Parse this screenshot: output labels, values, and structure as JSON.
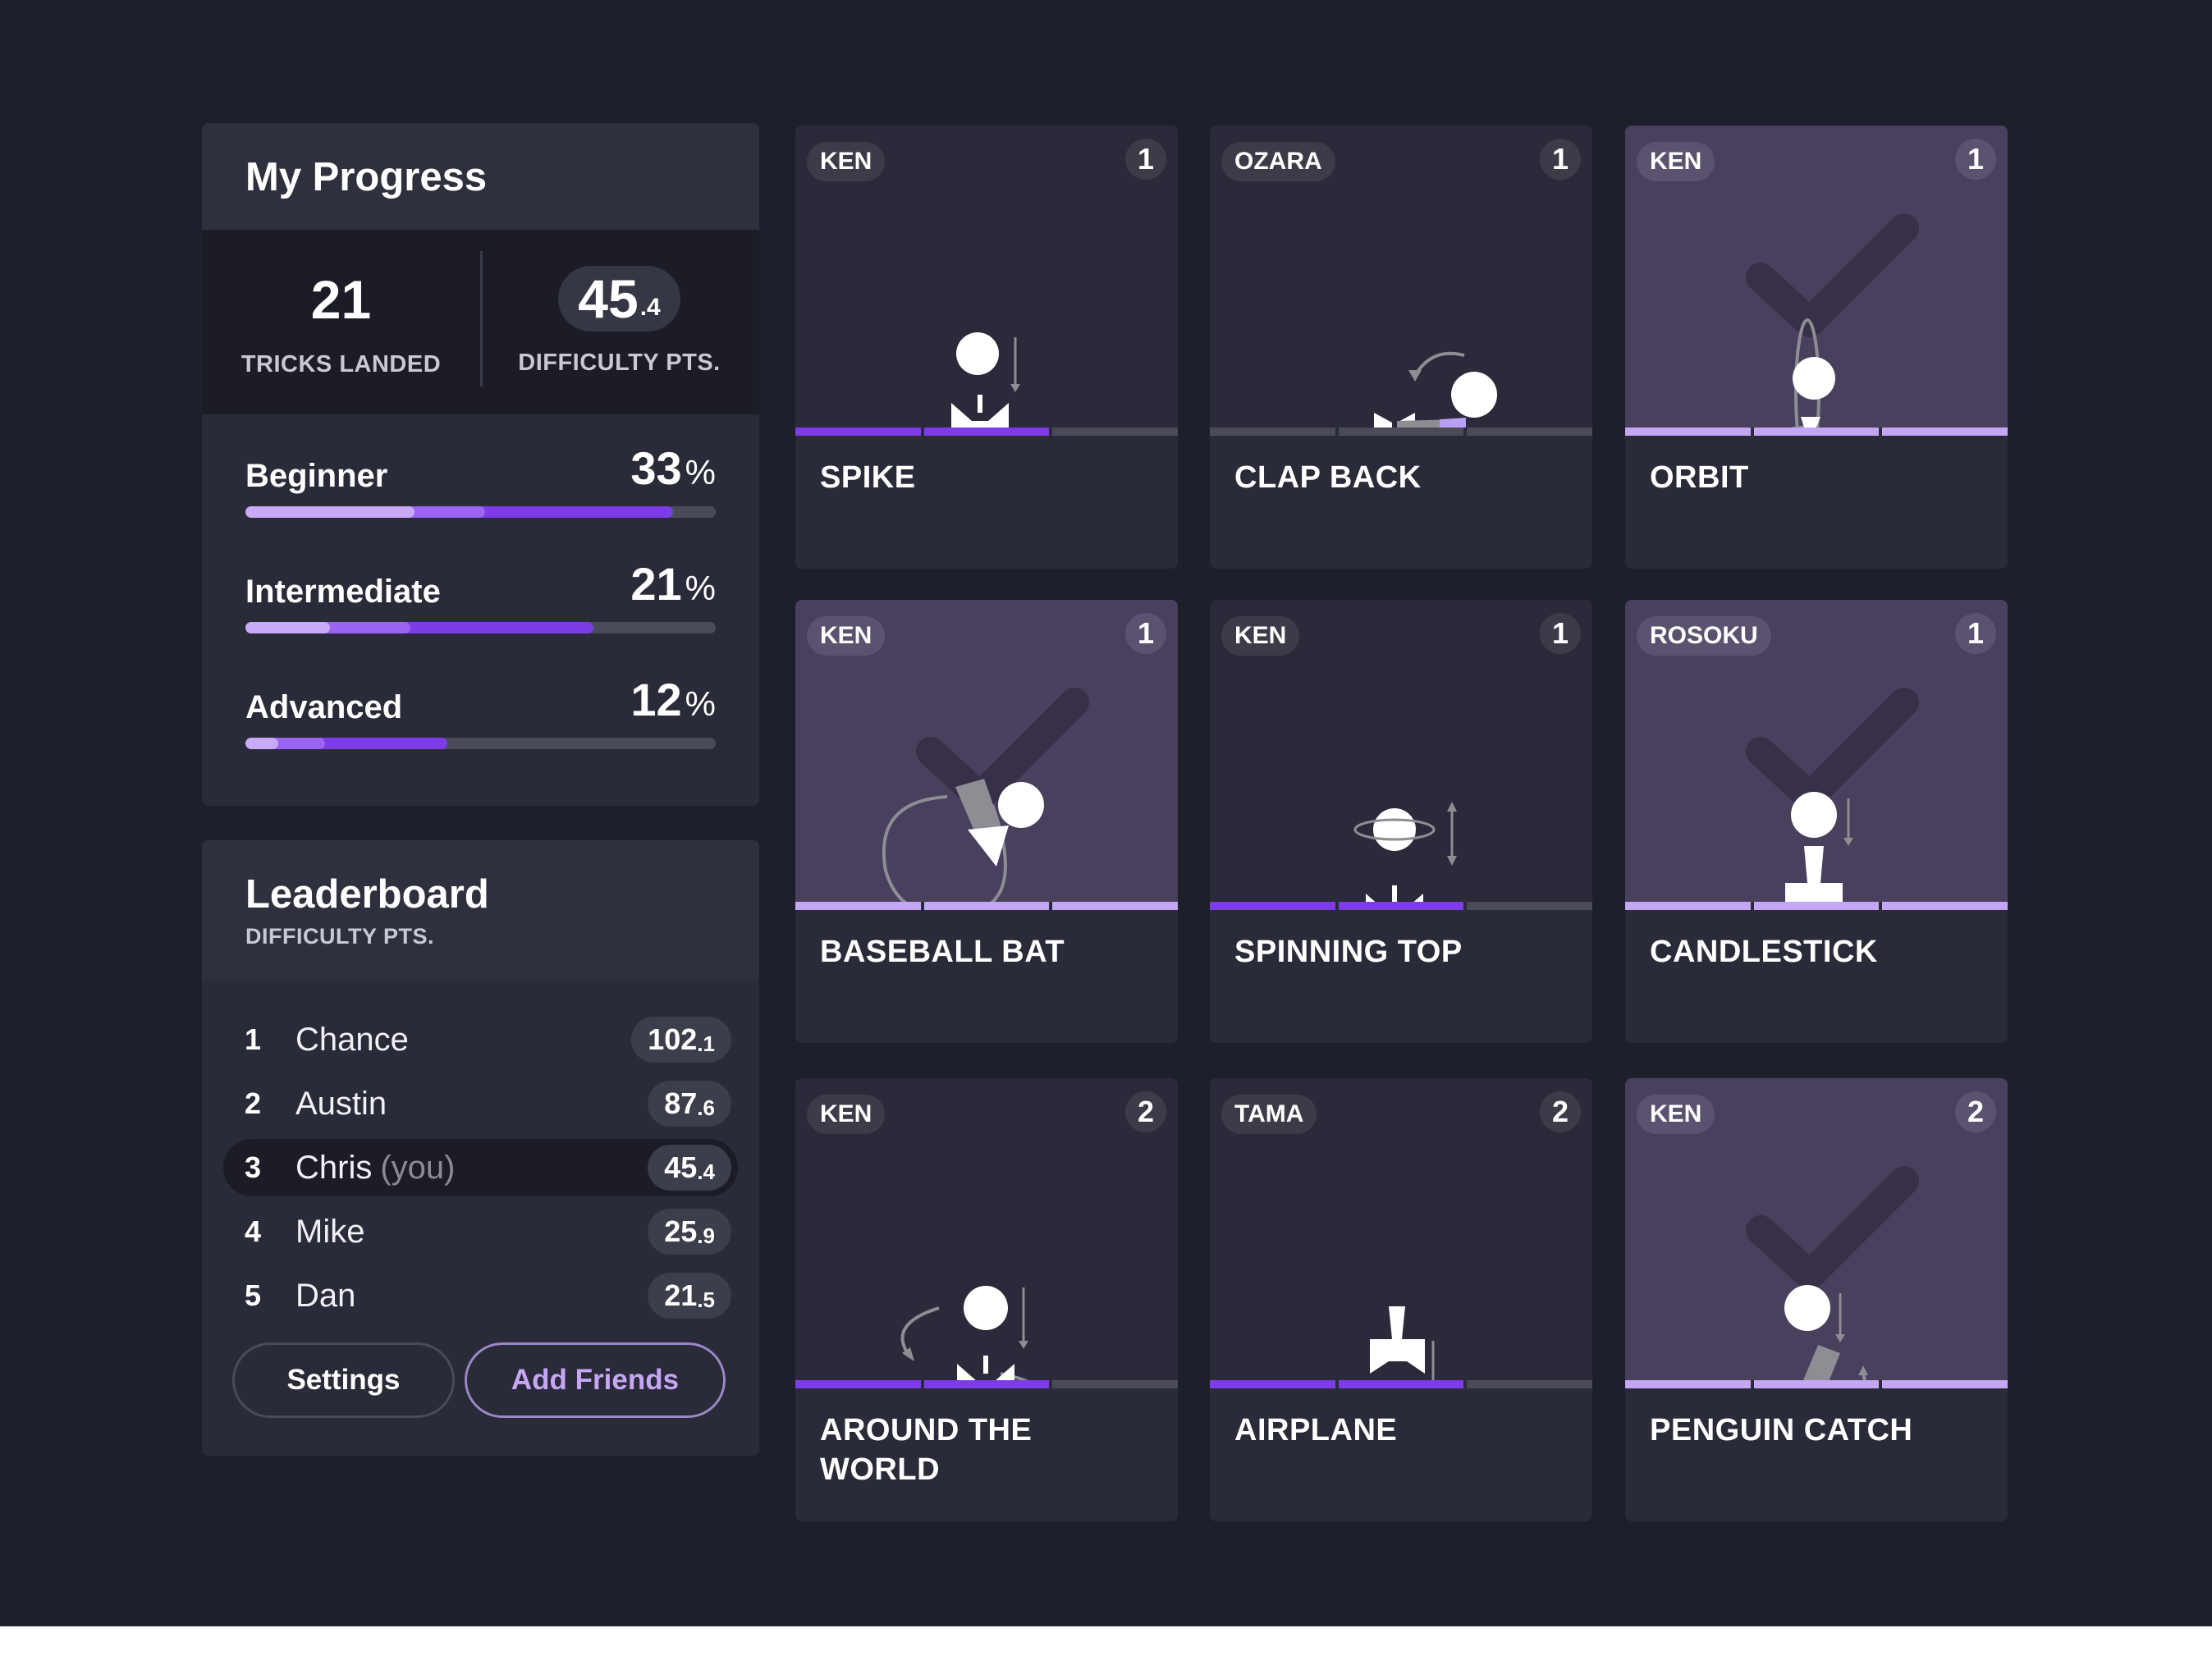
{
  "colors": {
    "background": "#1d1f2b",
    "panel": "#2a2b38",
    "accent_purple": "#7d3ce8",
    "accent_light_purple": "#c4a6f4",
    "landed_card": "#49405e"
  },
  "progress": {
    "title": "My Progress",
    "tricks_landed": "21",
    "tricks_landed_label": "TRICKS LANDED",
    "difficulty_main": "45",
    "difficulty_decimal": ".4",
    "difficulty_label": "DIFFICULTY PTS.",
    "levels": [
      {
        "name": "Beginner",
        "percent": "33",
        "pct_sign": "%",
        "bar": [
          0.36,
          0.51,
          0.91
        ]
      },
      {
        "name": "Intermediate",
        "percent": "21",
        "pct_sign": "%",
        "bar": [
          0.18,
          0.35,
          0.74
        ]
      },
      {
        "name": "Advanced",
        "percent": "12",
        "pct_sign": "%",
        "bar": [
          0.07,
          0.17,
          0.43
        ]
      }
    ]
  },
  "leaderboard": {
    "title": "Leaderboard",
    "subtitle": "DIFFICULTY PTS.",
    "rows": [
      {
        "rank": "1",
        "name": "Chance",
        "you": "",
        "score": "102",
        "decimal": ".1"
      },
      {
        "rank": "2",
        "name": "Austin",
        "you": "",
        "score": "87",
        "decimal": ".6"
      },
      {
        "rank": "3",
        "name": "Chris",
        "you": "(you)",
        "score": "45",
        "decimal": ".4"
      },
      {
        "rank": "4",
        "name": "Mike",
        "you": "",
        "score": "25",
        "decimal": ".9"
      },
      {
        "rank": "5",
        "name": "Dan",
        "you": "",
        "score": "21",
        "decimal": ".5"
      }
    ],
    "settings_label": "Settings",
    "add_friends_label": "Add Friends"
  },
  "cards": [
    {
      "tag": "KEN",
      "num": "1",
      "name": "SPIKE",
      "landed": false,
      "progress": 2,
      "icon": "spike-icon"
    },
    {
      "tag": "OZARA",
      "num": "1",
      "name": "CLAP BACK",
      "landed": false,
      "progress": 0,
      "icon": "clap-back-icon"
    },
    {
      "tag": "KEN",
      "num": "1",
      "name": "ORBIT",
      "landed": true,
      "progress": 3,
      "icon": "orbit-icon"
    },
    {
      "tag": "KEN",
      "num": "1",
      "name": "BASEBALL BAT",
      "landed": true,
      "progress": 3,
      "icon": "baseball-bat-icon"
    },
    {
      "tag": "KEN",
      "num": "1",
      "name": "SPINNING TOP",
      "landed": false,
      "progress": 2,
      "icon": "spinning-top-icon"
    },
    {
      "tag": "ROSOKU",
      "num": "1",
      "name": "CANDLESTICK",
      "landed": true,
      "progress": 3,
      "icon": "candlestick-icon"
    },
    {
      "tag": "KEN",
      "num": "2",
      "name": "AROUND THE WORLD",
      "landed": false,
      "progress": 2,
      "icon": "around-the-world-icon"
    },
    {
      "tag": "TAMA",
      "num": "2",
      "name": "AIRPLANE",
      "landed": false,
      "progress": 2,
      "icon": "airplane-icon"
    },
    {
      "tag": "KEN",
      "num": "2",
      "name": "PENGUIN CATCH",
      "landed": true,
      "progress": 3,
      "icon": "penguin-catch-icon"
    }
  ]
}
